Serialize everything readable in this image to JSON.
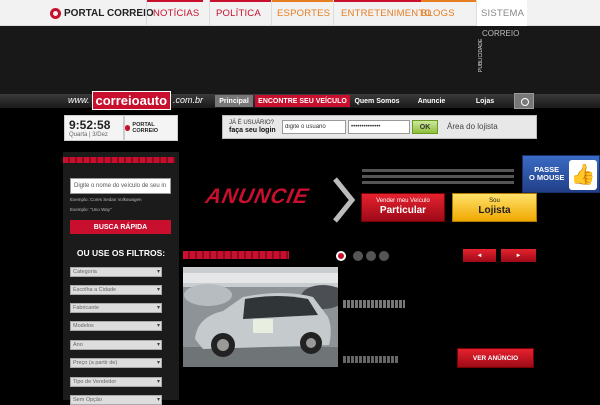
{
  "topnav": {
    "logo": "PORTAL CORREIO",
    "items": [
      {
        "label": "NOTÍCIAS",
        "color": "#c8102e"
      },
      {
        "label": "POLÍTICA",
        "color": "#c8102e"
      },
      {
        "label": "ESPORTES",
        "color": "#c8102e"
      },
      {
        "label": "ENTRETENIMENTO",
        "color": "#c8102e"
      },
      {
        "label": "BLOGS",
        "color": "#e67e22"
      },
      {
        "label": "SISTEMA",
        "color": "#888888"
      }
    ],
    "stripe_colors": [
      "#c8102e",
      "#c8102e",
      "#e67e22",
      "#c8102e",
      "#e67e22"
    ]
  },
  "ad_banner": {
    "sistema_sub": "CORREIO",
    "publicidade": "PUBLICIDADE"
  },
  "site": {
    "logo_prefix": "www.",
    "logo_main": "correioauto",
    "logo_suffix": ".com.br",
    "menu": [
      "Principal",
      "ENCONTRE SEU VEÍCULO",
      "Quem Somos",
      "Anuncie",
      "Lojas"
    ],
    "menu_icons": [
      "camera-icon"
    ]
  },
  "clock": {
    "time": "9:52:58",
    "date": "Quarta | 3/Dez",
    "logo": "PORTAL CORREIO"
  },
  "login": {
    "label_line1": "JÁ É USUÁRIO?",
    "label_line2": "faça seu login",
    "user_value": "digite o usuário",
    "password_value": "••••••••••••••",
    "ok_label": "OK",
    "area_lojista": "Área do lojista"
  },
  "search": {
    "placeholder": "Digite o nome do veículo de seu in",
    "example1": "Exemplo: Cores Sedan Volkswagen",
    "example2": "Exemplo: \"Uno Way\"",
    "button": "BUSCA RÁPIDA"
  },
  "filters": {
    "title": "OU USE OS FILTROS:",
    "items": [
      "Categoria",
      "Escolha a Cidade",
      "Fabricante",
      "Modelos",
      "Ano",
      "Preço (a partir de)",
      "Tipo de Vendedor",
      "Sem Opção"
    ]
  },
  "promo": {
    "anuncie": "ANUNCIE",
    "particular_small": "Vender meu Veículo",
    "particular_big": "Particular",
    "lojista_small": "Sou",
    "lojista_big": "Lojista"
  },
  "passe": {
    "line1": "PASSE",
    "line2": "O MOUSE"
  },
  "featured": {
    "prev_label": "◄",
    "next_label": "►",
    "ver_anuncio": "VER ANÚNCIO"
  }
}
